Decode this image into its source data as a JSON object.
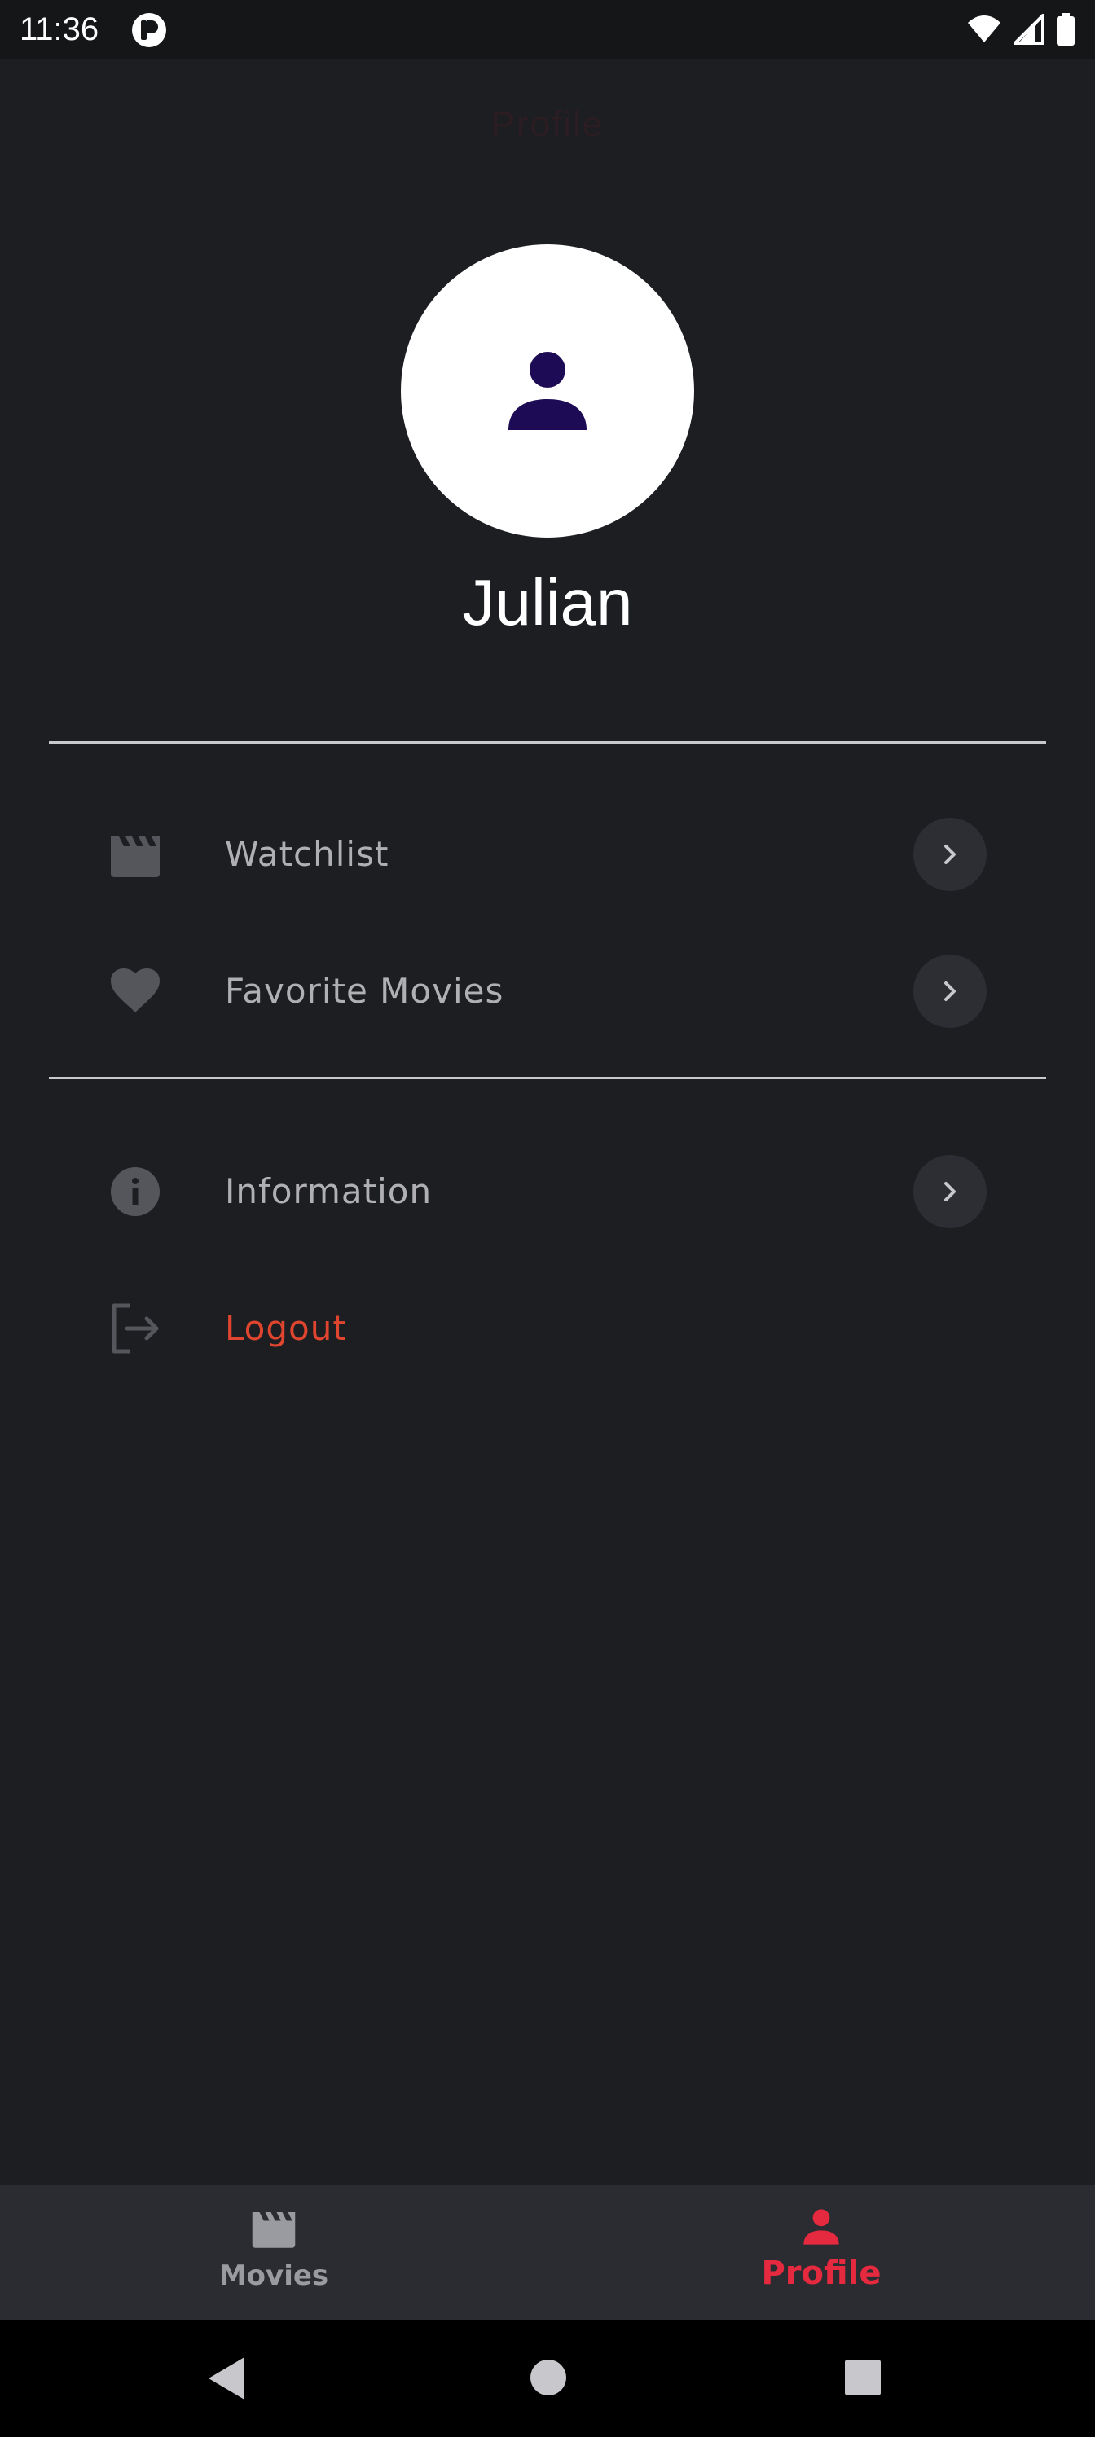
{
  "status_bar": {
    "time": "11:36"
  },
  "header": {
    "title": "Profile"
  },
  "profile": {
    "name": "Julian"
  },
  "menu": {
    "watchlist": {
      "label": "Watchlist",
      "icon": "clapperboard-icon"
    },
    "favorites": {
      "label": "Favorite Movies",
      "icon": "heart-icon"
    },
    "information": {
      "label": "Information",
      "icon": "info-icon"
    },
    "logout": {
      "label": "Logout",
      "icon": "logout-icon"
    }
  },
  "bottom_nav": {
    "items": [
      {
        "label": "Movies",
        "icon": "clapperboard-icon",
        "active": false
      },
      {
        "label": "Profile",
        "icon": "person-icon",
        "active": true
      }
    ]
  },
  "colors": {
    "background": "#1c1e21",
    "accent": "#e52a3f",
    "logout": "#e0452f",
    "avatar_icon": "#1e0b55"
  }
}
